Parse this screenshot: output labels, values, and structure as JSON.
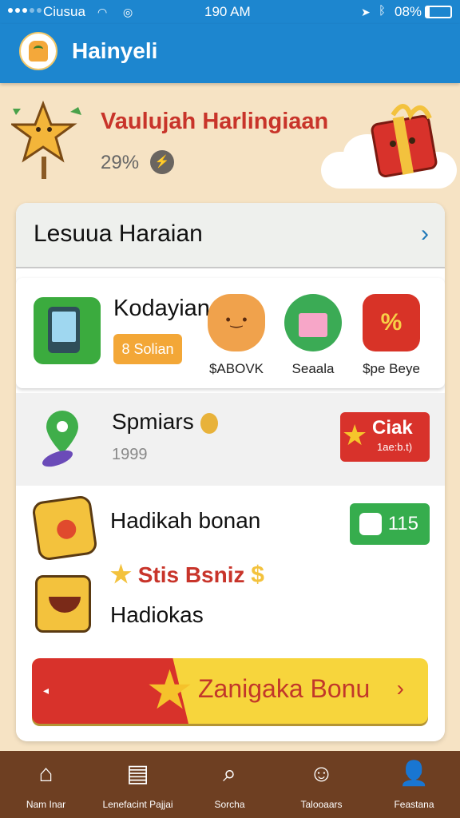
{
  "status_bar": {
    "carrier": "Ciusua",
    "time": "190 AM",
    "battery": "08%"
  },
  "header": {
    "title": "Hainyeli"
  },
  "hero": {
    "title": "Vaulujah Harlingiaan",
    "percent": "29%"
  },
  "card": {
    "title": "Lesuua Haraian",
    "row1": {
      "title": "Kodayian",
      "button": "8 Solian",
      "items": [
        {
          "label": "$ABOVK"
        },
        {
          "label": "Seaala"
        },
        {
          "label": "$pe Beye"
        }
      ]
    },
    "row2": {
      "title": "Spmiars",
      "count": "1999",
      "button_title": "Ciak",
      "button_sub": "1ae:b.t)"
    },
    "row3": {
      "title": "Hadikah bonan",
      "button": "115",
      "bonus": "Stis Bsniz",
      "subtitle": "Hadiokas"
    },
    "cta": {
      "label": "Zanigaka Bonu"
    }
  },
  "bottom_nav": [
    {
      "label": "Nam Inar",
      "icon": "home-icon"
    },
    {
      "label": "Lenefacint Pajjai",
      "icon": "news-icon"
    },
    {
      "label": "Sorcha",
      "icon": "search-icon"
    },
    {
      "label": "Talooaars",
      "icon": "face-icon"
    },
    {
      "label": "Feastana",
      "icon": "user-icon"
    }
  ],
  "colors": {
    "primary": "#1d86cf",
    "background": "#f6e3c4",
    "accent_red": "#d8322b",
    "accent_yellow": "#f7d53c",
    "accent_green": "#36ad4d",
    "nav": "#6e3f22"
  }
}
